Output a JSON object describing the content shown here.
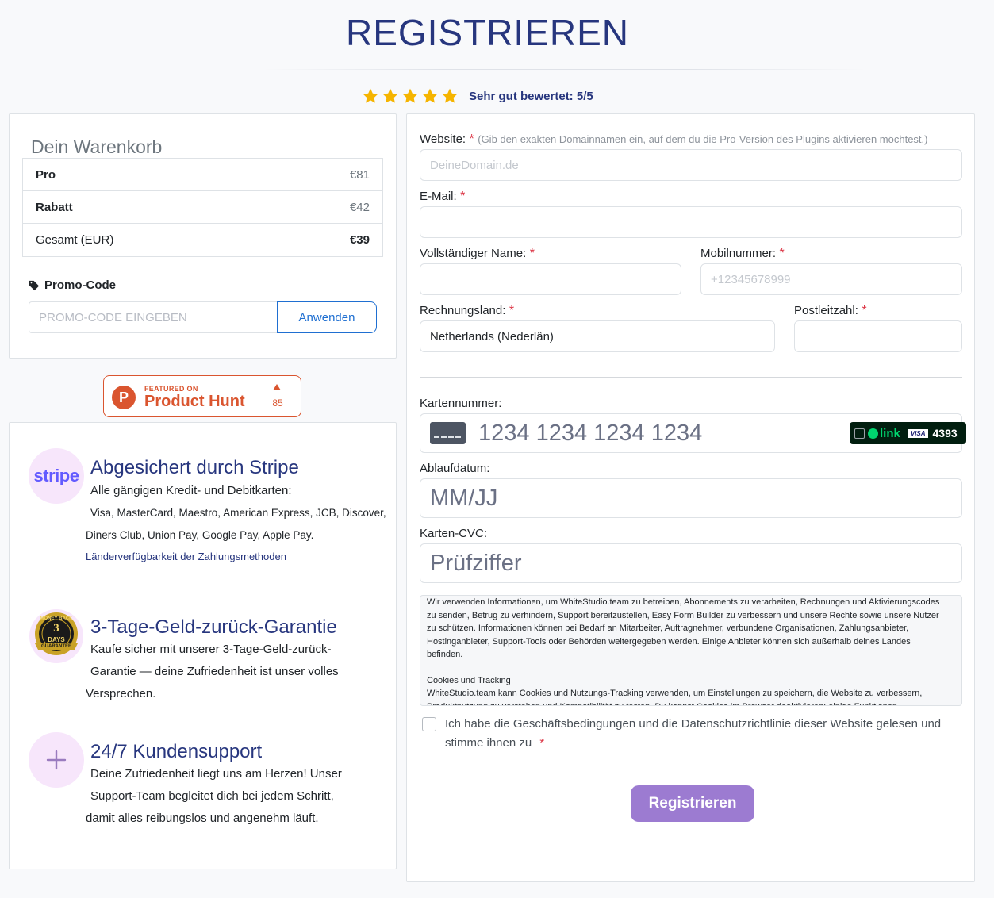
{
  "title": "REGISTRIEREN",
  "rating": {
    "stars": 5,
    "text": "Sehr gut bewertet: 5/5"
  },
  "cart": {
    "title": "Dein Warenkorb",
    "rows": [
      {
        "label": "Pro",
        "value": "€81"
      },
      {
        "label": "Rabatt",
        "value": "€42"
      },
      {
        "label": "Gesamt (EUR)",
        "value": "€39"
      }
    ]
  },
  "promo": {
    "label": "Promo-Code",
    "placeholder": "PROMO-CODE EINGEBEN",
    "button": "Anwenden"
  },
  "product_hunt": {
    "featured": "FEATURED ON",
    "name": "Product Hunt",
    "count": "85",
    "logo_letter": "P"
  },
  "features": {
    "stripe": {
      "icon_text": "stripe",
      "title": "Abgesichert durch Stripe",
      "line1": "Alle gängigen Kredit- und Debitkarten:",
      "line2": "Visa, MasterCard, Maestro, American Express, JCB, Discover,",
      "line3": "Diners Club, Union Pay, Google Pay, Apple Pay.",
      "link": "Länderverfügbarkeit der Zahlungsmethoden"
    },
    "guarantee": {
      "badge_top": "MONEY BACK",
      "badge_num": "3",
      "badge_days": "DAYS",
      "badge_bottom": "GUARANTEE",
      "title": "3-Tage-Geld-zurück-Garantie",
      "line1": "Kaufe sicher mit unserer 3-Tage-Geld-zurück-",
      "line2": "Garantie — deine Zufriedenheit ist unser volles",
      "line3": "Versprechen."
    },
    "support": {
      "title": "24/7 Kundensupport",
      "line1": "Deine Zufriedenheit liegt uns am Herzen! Unser",
      "line2": "Support-Team begleitet dich bei jedem Schritt,",
      "line3": "damit alles reibungslos und angenehm läuft."
    }
  },
  "form": {
    "website": {
      "label": "Website:",
      "required": "*",
      "hint": "(Gib den exakten Domainnamen ein, auf dem du die Pro-Version des Plugins aktivieren möchtest.)",
      "placeholder": "DeineDomain.de"
    },
    "email": {
      "label": "E-Mail:",
      "required": "*"
    },
    "name": {
      "label": "Vollständiger Name:",
      "required": "*"
    },
    "mobile": {
      "label": "Mobilnummer:",
      "required": "*",
      "placeholder": "+12345678999"
    },
    "country": {
      "label": "Rechnungsland:",
      "required": "*",
      "value": "Netherlands (Nederlân)"
    },
    "zip": {
      "label": "Postleitzahl:",
      "required": "*"
    },
    "card_number": {
      "label": "Kartennummer:",
      "placeholder": "1234 1234 1234 1234",
      "link_text": "link",
      "visa_text": "VISA",
      "last4": "4393"
    },
    "expiry": {
      "label": "Ablaufdatum:",
      "placeholder": "MM/JJ"
    },
    "cvc": {
      "label": "Karten-CVC:",
      "placeholder": "Prüfziffer"
    },
    "terms_text": {
      "p1": "Wir verwenden Informationen, um WhiteStudio.team zu betreiben, Abonnements zu verarbeiten, Rechnungen und Aktivierungscodes zu senden, Betrug zu verhindern, Support bereitzustellen, Easy Form Builder zu verbessern und unsere Rechte sowie unsere Nutzer zu schützen. Informationen können bei Bedarf an Mitarbeiter, Auftragnehmer, verbundene Organisationen, Zahlungsanbieter, Hostinganbieter, Support-Tools oder Behörden weitergegeben werden. Einige Anbieter können sich außerhalb deines Landes befinden.",
      "h2": "Cookies und Tracking",
      "p2": "WhiteStudio.team kann Cookies und Nutzungs-Tracking verwenden, um Einstellungen zu speichern, die Website zu verbessern, Produktnutzung zu verstehen und Kompatibilität zu testen. Du kannst Cookies im Browser deaktivieren; einige Funktionen"
    },
    "agree": {
      "text": "Ich habe die Geschäftsbedingungen und die Datenschutzrichtlinie dieser Website gelesen und stimme ihnen zu",
      "required": "*"
    },
    "submit": "Registrieren"
  },
  "colors": {
    "title": "#27367e",
    "accent_button": "#9c7bd1",
    "star": "#f5b400",
    "required": "#dc3545",
    "product_hunt": "#da552f",
    "link_blue": "#1f6fd1"
  },
  "icons": [
    "star-icon",
    "tag-icon",
    "stripe-icon",
    "guarantee-badge-icon",
    "plus-icon",
    "card-icon",
    "link-icon",
    "visa-icon"
  ]
}
